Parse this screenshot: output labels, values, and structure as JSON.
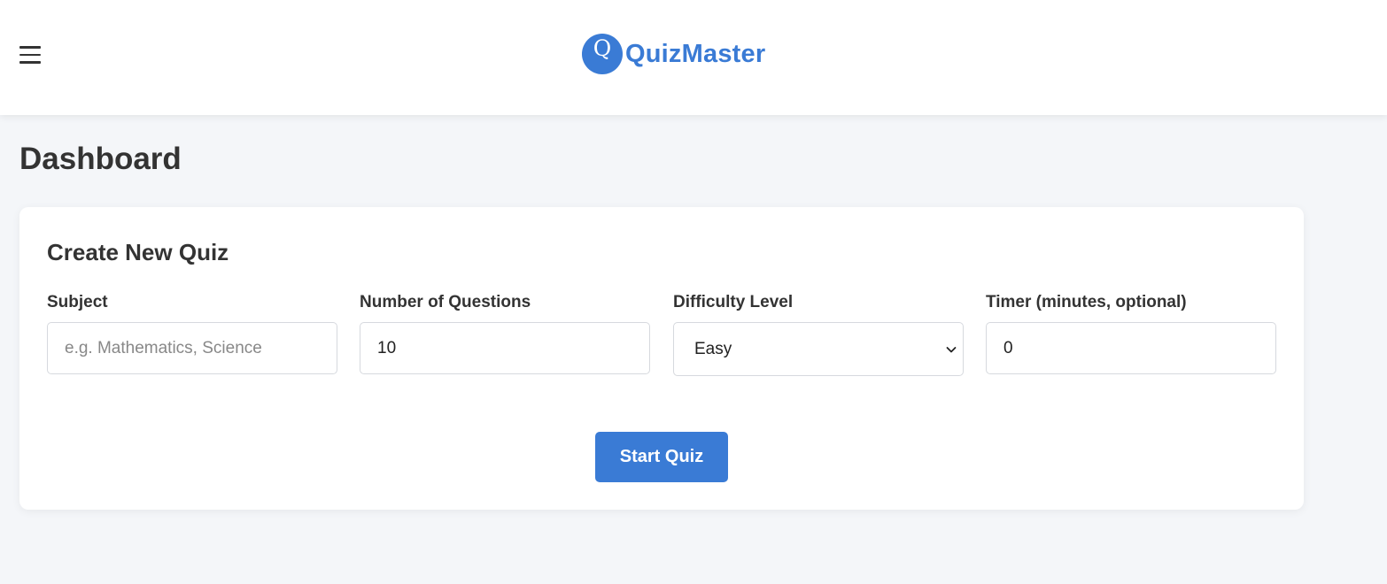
{
  "header": {
    "menu_icon": "hamburger-menu-icon",
    "logo_letter": "Q",
    "app_name": "QuizMaster",
    "brand_color": "#3a7bd5"
  },
  "page": {
    "title": "Dashboard"
  },
  "create_quiz": {
    "title": "Create New Quiz",
    "fields": [
      {
        "label": "Subject",
        "value": "",
        "placeholder": "e.g. Mathematics, Science"
      },
      {
        "label": "Number of Questions",
        "value": "10"
      },
      {
        "label": "Difficulty Level",
        "value": "Easy"
      },
      {
        "label": "Timer (minutes, optional)",
        "value": "0"
      }
    ],
    "submit_label": "Start Quiz"
  }
}
